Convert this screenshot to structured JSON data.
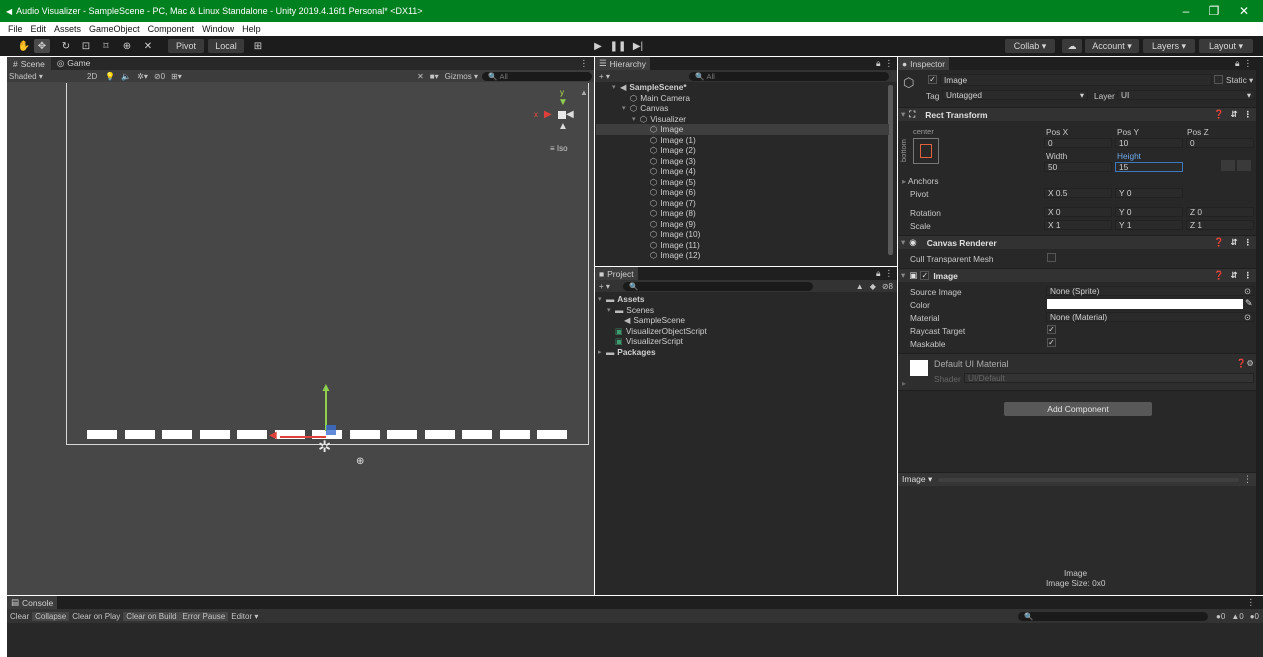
{
  "window": {
    "title": "Audio Visualizer - SampleScene - PC, Mac & Linux Standalone - Unity 2019.4.16f1 Personal* <DX11>",
    "minimize": "–",
    "maximize": "❐",
    "close": "✕"
  },
  "menu": [
    "File",
    "Edit",
    "Assets",
    "GameObject",
    "Component",
    "Window",
    "Help"
  ],
  "toolbar": {
    "pivot": "Pivot",
    "local": "Local",
    "collab": "Collab ▾",
    "account": "Account ▾",
    "layers": "Layers ▾",
    "layout": "Layout ▾"
  },
  "scene": {
    "tab_scene": "Scene",
    "tab_game": "Game",
    "shading": "Shaded",
    "mode_2d": "2D",
    "gizmos": "Gizmos ▾",
    "search_placeholder": "All",
    "fx_count": "0",
    "iso": "≡ Iso",
    "axis_x": "x",
    "axis_y": "y",
    "bar_count": 13
  },
  "hierarchy": {
    "tab": "Hierarchy",
    "search_placeholder": "All",
    "add": "+ ▾",
    "items": [
      {
        "label": "SampleScene*",
        "depth": 0,
        "kind": "scene"
      },
      {
        "label": "Main Camera",
        "depth": 1,
        "kind": "object"
      },
      {
        "label": "Canvas",
        "depth": 1,
        "kind": "object"
      },
      {
        "label": "Visualizer",
        "depth": 2,
        "kind": "object"
      },
      {
        "label": "Image",
        "depth": 3,
        "kind": "object",
        "selected": true
      },
      {
        "label": "Image (1)",
        "depth": 3,
        "kind": "object"
      },
      {
        "label": "Image (2)",
        "depth": 3,
        "kind": "object"
      },
      {
        "label": "Image (3)",
        "depth": 3,
        "kind": "object"
      },
      {
        "label": "Image (4)",
        "depth": 3,
        "kind": "object"
      },
      {
        "label": "Image (5)",
        "depth": 3,
        "kind": "object"
      },
      {
        "label": "Image (6)",
        "depth": 3,
        "kind": "object"
      },
      {
        "label": "Image (7)",
        "depth": 3,
        "kind": "object"
      },
      {
        "label": "Image (8)",
        "depth": 3,
        "kind": "object"
      },
      {
        "label": "Image (9)",
        "depth": 3,
        "kind": "object"
      },
      {
        "label": "Image (10)",
        "depth": 3,
        "kind": "object"
      },
      {
        "label": "Image (11)",
        "depth": 3,
        "kind": "object"
      },
      {
        "label": "Image (12)",
        "depth": 3,
        "kind": "object"
      }
    ]
  },
  "project": {
    "tab": "Project",
    "add": "+ ▾",
    "hidden_count": "8",
    "items": [
      {
        "label": "Assets",
        "depth": 0,
        "kind": "folder"
      },
      {
        "label": "Scenes",
        "depth": 1,
        "kind": "folder"
      },
      {
        "label": "SampleScene",
        "depth": 2,
        "kind": "scene"
      },
      {
        "label": "VisualizerObjectScript",
        "depth": 1,
        "kind": "script"
      },
      {
        "label": "VisualizerScript",
        "depth": 1,
        "kind": "script"
      },
      {
        "label": "Packages",
        "depth": 0,
        "kind": "folder"
      }
    ]
  },
  "inspector": {
    "tab": "Inspector",
    "object_name": "Image",
    "static": "Static ▾",
    "tag_label": "Tag",
    "tag_value": "Untagged",
    "layer_label": "Layer",
    "layer_value": "UI",
    "rect_transform": {
      "title": "Rect Transform",
      "anchor_h": "center",
      "anchor_v": "bottom",
      "posx_label": "Pos X",
      "posx": "0",
      "posy_label": "Pos Y",
      "posy": "10",
      "posz_label": "Pos Z",
      "posz": "0",
      "width_label": "Width",
      "width": "50",
      "height_label": "Height",
      "height": "15",
      "anchors": "Anchors",
      "pivot": "Pivot",
      "pivot_x": "0.5",
      "pivot_y": "0",
      "rotation": "Rotation",
      "rot_x": "0",
      "rot_y": "0",
      "rot_z": "0",
      "scale": "Scale",
      "scale_x": "1",
      "scale_y": "1",
      "scale_z": "1"
    },
    "canvas_renderer": {
      "title": "Canvas Renderer",
      "cull_label": "Cull Transparent Mesh"
    },
    "image": {
      "title": "Image",
      "source_label": "Source Image",
      "source_value": "None (Sprite)",
      "color_label": "Color",
      "color_value": "#ffffff",
      "material_label": "Material",
      "material_value": "None (Material)",
      "raycast_label": "Raycast Target",
      "maskable_label": "Maskable"
    },
    "material": {
      "name": "Default UI Material",
      "shader_label": "Shader",
      "shader_value": "UI/Default"
    },
    "add_component": "Add Component",
    "preview_tab": "Image ▾",
    "preview_name": "Image",
    "preview_size": "Image Size: 0x0"
  },
  "console": {
    "tab": "Console",
    "buttons": [
      "Clear",
      "Collapse",
      "Clear on Play",
      "Clear on Build",
      "Error Pause",
      "Editor ▾"
    ],
    "info_count": "0",
    "warn_count": "0",
    "error_count": "0"
  },
  "colors": {
    "titlebar": "#00811f",
    "panel": "#282828",
    "selection": "#2c5d87",
    "height_field_highlight": "#3a79bb"
  }
}
